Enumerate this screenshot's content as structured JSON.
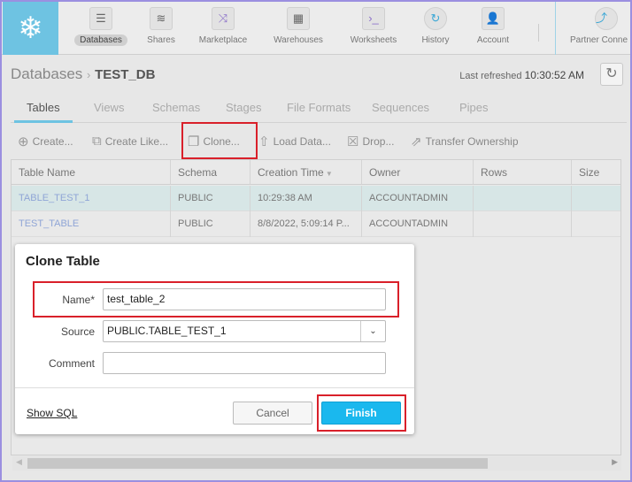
{
  "nav": {
    "items": [
      {
        "label": "Databases",
        "icon": "database-icon",
        "active": true
      },
      {
        "label": "Shares",
        "icon": "shares-icon"
      },
      {
        "label": "Marketplace",
        "icon": "shuffle-icon"
      },
      {
        "label": "Warehouses",
        "icon": "grid-icon"
      },
      {
        "label": "Worksheets",
        "icon": "terminal-icon"
      },
      {
        "label": "History",
        "icon": "history-icon"
      },
      {
        "label": "Account",
        "icon": "user-icon"
      },
      {
        "label": "Partner Conne",
        "icon": "partner-connect-icon"
      }
    ]
  },
  "breadcrumb": {
    "root": "Databases",
    "current": "TEST_DB"
  },
  "refresh": {
    "label": "Last refreshed",
    "time": "10:30:52 AM"
  },
  "tabs": [
    "Tables",
    "Views",
    "Schemas",
    "Stages",
    "File Formats",
    "Sequences",
    "Pipes"
  ],
  "toolbar": {
    "create": "Create...",
    "create_like": "Create Like...",
    "clone": "Clone...",
    "load": "Load Data...",
    "drop": "Drop...",
    "transfer": "Transfer Ownership"
  },
  "table": {
    "columns": [
      "Table Name",
      "Schema",
      "Creation Time",
      "Owner",
      "Rows",
      "Size"
    ],
    "rows": [
      [
        "TABLE_TEST_1",
        "PUBLIC",
        "10:29:38 AM",
        "ACCOUNTADMIN",
        "",
        ""
      ],
      [
        "TEST_TABLE",
        "PUBLIC",
        "8/8/2022, 5:09:14 P...",
        "ACCOUNTADMIN",
        "",
        ""
      ]
    ]
  },
  "dialog": {
    "title": "Clone Table",
    "name_label": "Name",
    "required": "*",
    "name_value": "test_table_2",
    "source_label": "Source",
    "source_value": "PUBLIC.TABLE_TEST_1",
    "comment_label": "Comment",
    "comment_value": "",
    "show_sql": "Show SQL",
    "cancel": "Cancel",
    "finish": "Finish"
  },
  "colors": {
    "accent": "#6ec3e2",
    "finish": "#1ab8ee",
    "highlight": "#d9202a"
  }
}
